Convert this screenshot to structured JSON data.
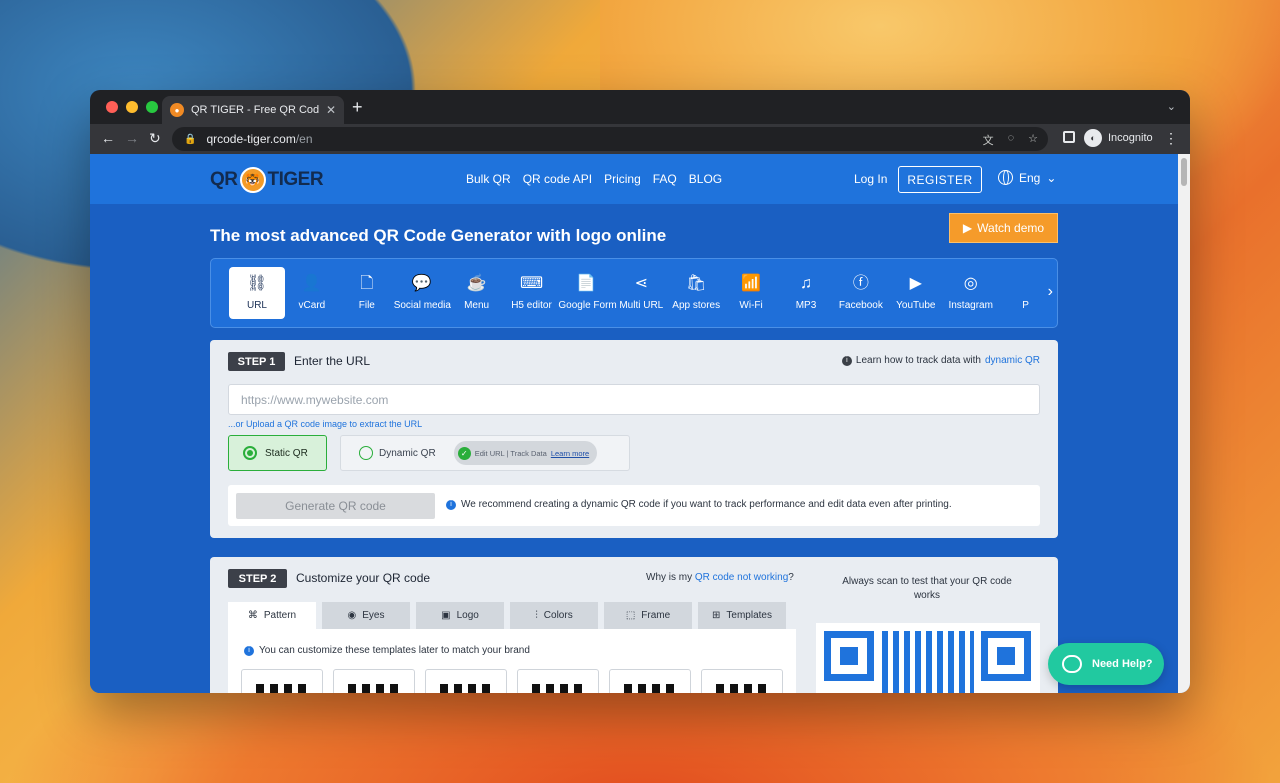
{
  "browser": {
    "tab_title": "QR TIGER - Free QR Code Gene",
    "url_host": "qrcode-tiger.com",
    "url_path": "/en",
    "profile_label": "Incognito"
  },
  "site": {
    "logo_left": "QR",
    "logo_right": "TIGER",
    "nav": [
      "Bulk QR",
      "QR code API",
      "Pricing",
      "FAQ",
      "BLOG"
    ],
    "login": "Log In",
    "register": "REGISTER",
    "language": "Eng"
  },
  "hero": {
    "title": "The most advanced QR Code Generator with logo online",
    "watch_demo": "Watch demo"
  },
  "types": [
    {
      "label": "URL",
      "icon": "link-icon",
      "glyph": "⛓",
      "active": true
    },
    {
      "label": "vCard",
      "icon": "person-icon",
      "glyph": "👤"
    },
    {
      "label": "File",
      "icon": "file-icon",
      "glyph": "🗋"
    },
    {
      "label": "Social media",
      "icon": "chat-bubble-icon",
      "glyph": "💬"
    },
    {
      "label": "Menu",
      "icon": "coffee-cup-icon",
      "glyph": "☕"
    },
    {
      "label": "H5 editor",
      "icon": "html-icon",
      "glyph": "⌨"
    },
    {
      "label": "Google Form",
      "icon": "form-icon",
      "glyph": "📄"
    },
    {
      "label": "Multi URL",
      "icon": "share-icon",
      "glyph": "⋖"
    },
    {
      "label": "App stores",
      "icon": "shopping-bag-icon",
      "glyph": "🛍"
    },
    {
      "label": "Wi-Fi",
      "icon": "wifi-icon",
      "glyph": "📶"
    },
    {
      "label": "MP3",
      "icon": "music-note-icon",
      "glyph": "♫"
    },
    {
      "label": "Facebook",
      "icon": "facebook-icon",
      "glyph": "ⓕ"
    },
    {
      "label": "YouTube",
      "icon": "youtube-icon",
      "glyph": "▶"
    },
    {
      "label": "Instagram",
      "icon": "instagram-icon",
      "glyph": "◎"
    },
    {
      "label": "P",
      "icon": "partial-icon",
      "glyph": ""
    }
  ],
  "step1": {
    "badge": "STEP 1",
    "title": "Enter the URL",
    "learn_prefix": "Learn how to track data with",
    "learn_link": "dynamic QR",
    "url_placeholder": "https://www.mywebsite.com",
    "upload_link": "...or Upload a QR code image to extract the URL",
    "static_label": "Static QR",
    "dynamic_label": "Dynamic QR",
    "dynamic_features": "Edit URL  |  Track Data",
    "dynamic_learn": "Learn more",
    "generate_button": "Generate QR code",
    "recommend_note": "We recommend creating a dynamic QR code if you want to track performance and edit data even after printing."
  },
  "step2": {
    "badge": "STEP 2",
    "title": "Customize your QR code",
    "why_prefix": "Why is my",
    "why_link": "QR code not working",
    "why_suffix": "?",
    "tabs": [
      {
        "label": "Pattern",
        "glyph": "⌘",
        "active": true
      },
      {
        "label": "Eyes",
        "glyph": "◉"
      },
      {
        "label": "Logo",
        "glyph": "▣"
      },
      {
        "label": "Colors",
        "glyph": "⫶"
      },
      {
        "label": "Frame",
        "glyph": "⬚"
      },
      {
        "label": "Templates",
        "glyph": "⊞"
      }
    ],
    "customize_note": "You can customize these templates later to match your brand",
    "scan_note": "Always scan to test that your QR code works"
  },
  "help": {
    "label": "Need Help?"
  },
  "colors": {
    "brand_blue": "#1f73dc",
    "accent_orange": "#f59b2a",
    "success_green": "#2aae3b",
    "help_teal": "#21c9a0"
  }
}
